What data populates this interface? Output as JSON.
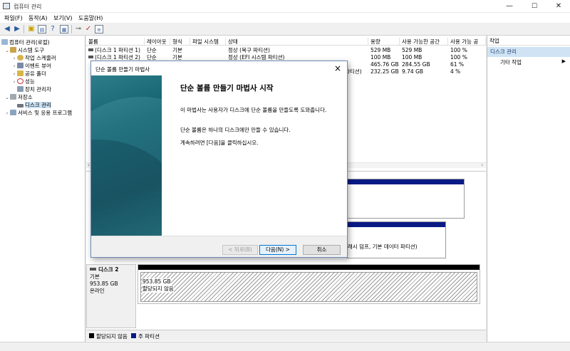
{
  "window": {
    "title": "컴퓨터 관리",
    "minimize": "—",
    "maximize": "☐",
    "close": "✕"
  },
  "menu": [
    "파일(F)",
    "동작(A)",
    "보기(V)",
    "도움말(H)"
  ],
  "tree": {
    "root": "컴퓨터 관리(로컬)",
    "system_tools": "시스템 도구",
    "task_scheduler": "작업 스케줄러",
    "event_viewer": "이벤트 뷰어",
    "shared_folders": "공유 폴더",
    "performance": "성능",
    "device_manager": "장치 관리자",
    "storage": "저장소",
    "disk_management": "디스크 관리",
    "services_apps": "서비스 및 응용 프로그램"
  },
  "volume_table": {
    "columns": [
      "볼륨",
      "레이아웃",
      "형식",
      "파일 시스템",
      "상태",
      "용량",
      "사용 가능한 공간",
      "사용 가능 공"
    ],
    "rows": [
      {
        "volume": "(디스크 1 파티션 1)",
        "layout": "단순",
        "type": "기본",
        "fs": "",
        "status": "정상 (복구 파티션)",
        "capacity": "529 MB",
        "free": "529 MB",
        "pct": "100 %"
      },
      {
        "volume": "(디스크 1 파티션 2)",
        "layout": "단순",
        "type": "기본",
        "fs": "",
        "status": "정상 (EFI 시스템 파티션)",
        "capacity": "100 MB",
        "free": "100 MB",
        "pct": "100 %"
      },
      {
        "volume": "",
        "layout": "",
        "type": "",
        "fs": "",
        "status": "",
        "capacity": "465.76 GB",
        "free": "284.55 GB",
        "pct": "61 %"
      },
      {
        "volume": "",
        "layout": "",
        "type": "",
        "fs": "",
        "status": "파티션)",
        "capacity": "232.25 GB",
        "free": "9.74 GB",
        "pct": "4 %"
      }
    ]
  },
  "graph": {
    "partial_partition_text": "크래시 덤프, 기본 데이터 파티션)",
    "disk2": {
      "name": "디스크 2",
      "type": "기본",
      "size": "953.85 GB",
      "status": "온라인",
      "region_size": "953.85 GB",
      "region_status": "할당되지 않음"
    }
  },
  "legend": {
    "unallocated": "할당되지 않음",
    "primary": "주 파티션",
    "colors": {
      "unallocated": "#000000",
      "primary": "#0a1a85"
    }
  },
  "actions": {
    "header": "작업",
    "selected": "디스크 관리",
    "more": "기타 작업"
  },
  "dialog": {
    "title": "단순 볼륨 만들기 마법사",
    "heading": "단순 볼륨 만들기 마법사 시작",
    "p1": "이 마법사는 사용자가 디스크에 단순 볼륨을 만들도록 도와줍니다.",
    "p2": "단순 볼륨은 하나의 디스크에만 만들 수 있습니다.",
    "p3": "계속하려면 [다음]을 클릭하십시오.",
    "back_button": "< 뒤로(B)",
    "next_button": "다음(N) >",
    "cancel_button": "취소"
  }
}
